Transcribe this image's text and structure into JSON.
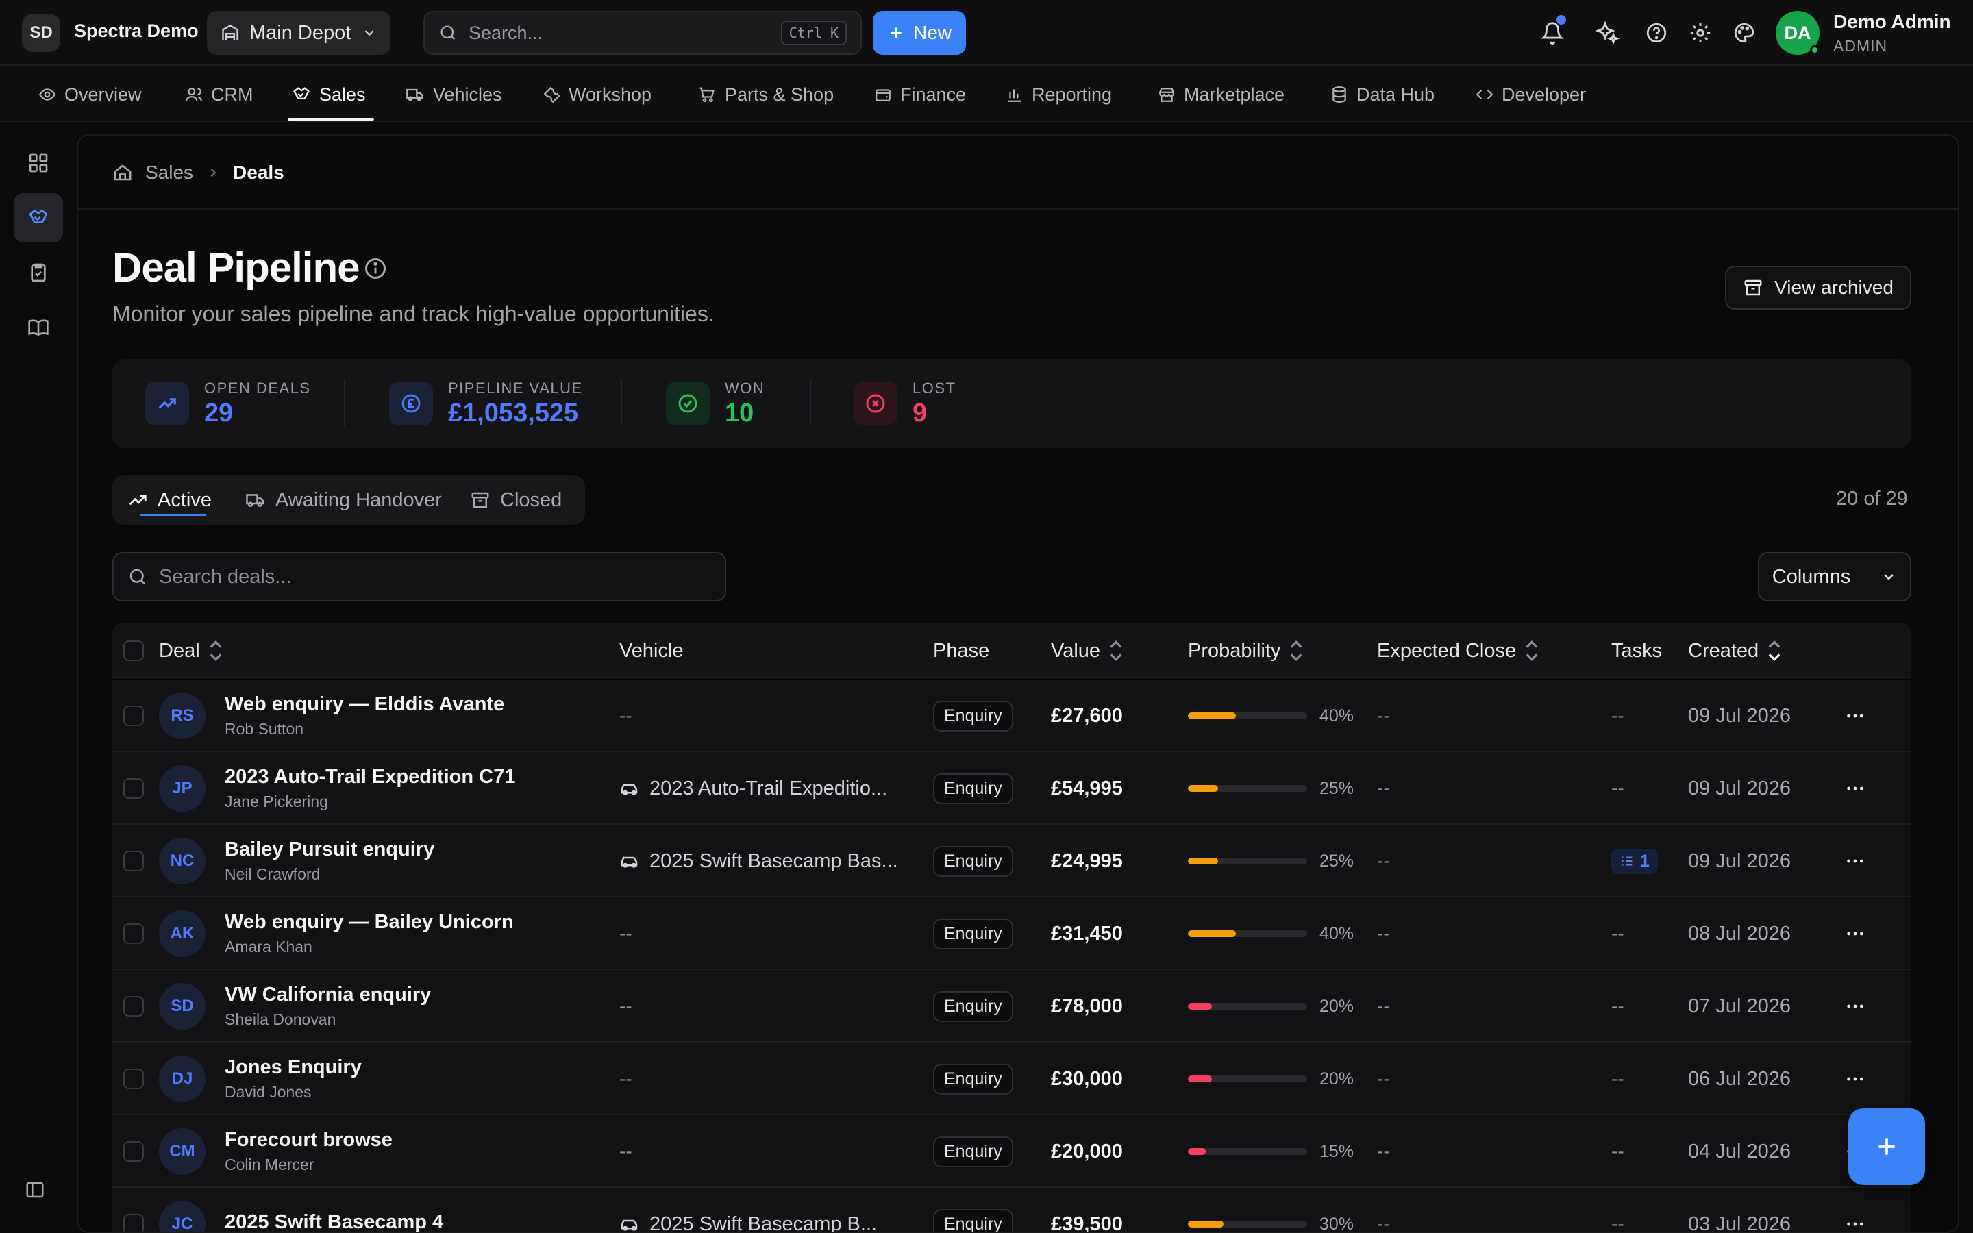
{
  "app": {
    "brand_initials": "SD",
    "brand_name": "Spectra Demo",
    "depot": "Main Depot",
    "search_placeholder": "Search...",
    "search_shortcut": "Ctrl K",
    "new_label": "New",
    "user": {
      "initials": "DA",
      "name": "Demo Admin",
      "role": "ADMIN"
    },
    "colors": {
      "accent": "#3b82f6",
      "success": "#22c55e",
      "danger": "#f43f5e",
      "warning": "#f59e0b"
    }
  },
  "nav": {
    "items": [
      {
        "label": "Overview",
        "icon": "eye-icon"
      },
      {
        "label": "CRM",
        "icon": "users-icon"
      },
      {
        "label": "Sales",
        "icon": "handshake-icon",
        "active": true
      },
      {
        "label": "Vehicles",
        "icon": "truck-icon"
      },
      {
        "label": "Workshop",
        "icon": "wrench-icon"
      },
      {
        "label": "Parts & Shop",
        "icon": "cart-icon"
      },
      {
        "label": "Finance",
        "icon": "wallet-icon"
      },
      {
        "label": "Reporting",
        "icon": "bar-chart-icon"
      },
      {
        "label": "Marketplace",
        "icon": "store-icon"
      },
      {
        "label": "Data Hub",
        "icon": "database-icon"
      },
      {
        "label": "Developer",
        "icon": "code-icon"
      }
    ]
  },
  "breadcrumb": {
    "root": "Sales",
    "current": "Deals"
  },
  "page": {
    "title": "Deal Pipeline",
    "subtitle": "Monitor your sales pipeline and track high-value opportunities.",
    "archived_label": "View archived"
  },
  "stats": {
    "open": {
      "label": "OPEN DEALS",
      "value": "29"
    },
    "pipeline": {
      "label": "PIPELINE VALUE",
      "value": "£1,053,525"
    },
    "won": {
      "label": "WON",
      "value": "10"
    },
    "lost": {
      "label": "LOST",
      "value": "9"
    }
  },
  "tabs": {
    "active": "Active",
    "handover": "Awaiting Handover",
    "closed": "Closed",
    "count": "20 of 29"
  },
  "filters": {
    "search_placeholder": "Search deals...",
    "columns_label": "Columns"
  },
  "table": {
    "headers": {
      "deal": "Deal",
      "vehicle": "Vehicle",
      "phase": "Phase",
      "value": "Value",
      "probability": "Probability",
      "expected_close": "Expected Close",
      "tasks": "Tasks",
      "created": "Created"
    },
    "rows": [
      {
        "initials": "RS",
        "title": "Web enquiry — Elddis Avante",
        "contact": "Rob Sutton",
        "vehicle": "--",
        "phase": "Enquiry",
        "value": "£27,600",
        "probability": 40,
        "probability_label": "40%",
        "expected_close": "--",
        "tasks": "--",
        "created": "09 Jul 2026"
      },
      {
        "initials": "JP",
        "title": "2023 Auto-Trail Expedition C71",
        "contact": "Jane Pickering",
        "vehicle": "2023 Auto-Trail Expeditio...",
        "phase": "Enquiry",
        "value": "£54,995",
        "probability": 25,
        "probability_label": "25%",
        "expected_close": "--",
        "tasks": "--",
        "created": "09 Jul 2026"
      },
      {
        "initials": "NC",
        "title": "Bailey Pursuit enquiry",
        "contact": "Neil Crawford",
        "vehicle": "2025 Swift Basecamp Bas...",
        "phase": "Enquiry",
        "value": "£24,995",
        "probability": 25,
        "probability_label": "25%",
        "expected_close": "--",
        "tasks": "1",
        "created": "09 Jul 2026"
      },
      {
        "initials": "AK",
        "title": "Web enquiry — Bailey Unicorn",
        "contact": "Amara Khan",
        "vehicle": "--",
        "phase": "Enquiry",
        "value": "£31,450",
        "probability": 40,
        "probability_label": "40%",
        "expected_close": "--",
        "tasks": "--",
        "created": "08 Jul 2026"
      },
      {
        "initials": "SD",
        "title": "VW California enquiry",
        "contact": "Sheila Donovan",
        "vehicle": "--",
        "phase": "Enquiry",
        "value": "£78,000",
        "probability": 20,
        "probability_label": "20%",
        "expected_close": "--",
        "tasks": "--",
        "created": "07 Jul 2026"
      },
      {
        "initials": "DJ",
        "title": "Jones Enquiry",
        "contact": "David Jones",
        "vehicle": "--",
        "phase": "Enquiry",
        "value": "£30,000",
        "probability": 20,
        "probability_label": "20%",
        "expected_close": "--",
        "tasks": "--",
        "created": "06 Jul 2026"
      },
      {
        "initials": "CM",
        "title": "Forecourt browse",
        "contact": "Colin Mercer",
        "vehicle": "--",
        "phase": "Enquiry",
        "value": "£20,000",
        "probability": 15,
        "probability_label": "15%",
        "expected_close": "--",
        "tasks": "--",
        "created": "04 Jul 2026"
      },
      {
        "initials": "JC",
        "title": "2025 Swift Basecamp 4",
        "contact": "",
        "vehicle": "2025 Swift Basecamp B...",
        "phase": "Enquiry",
        "value": "£39,500",
        "probability": 30,
        "probability_label": "30%",
        "expected_close": "--",
        "tasks": "--",
        "created": "03 Jul 2026"
      }
    ]
  }
}
